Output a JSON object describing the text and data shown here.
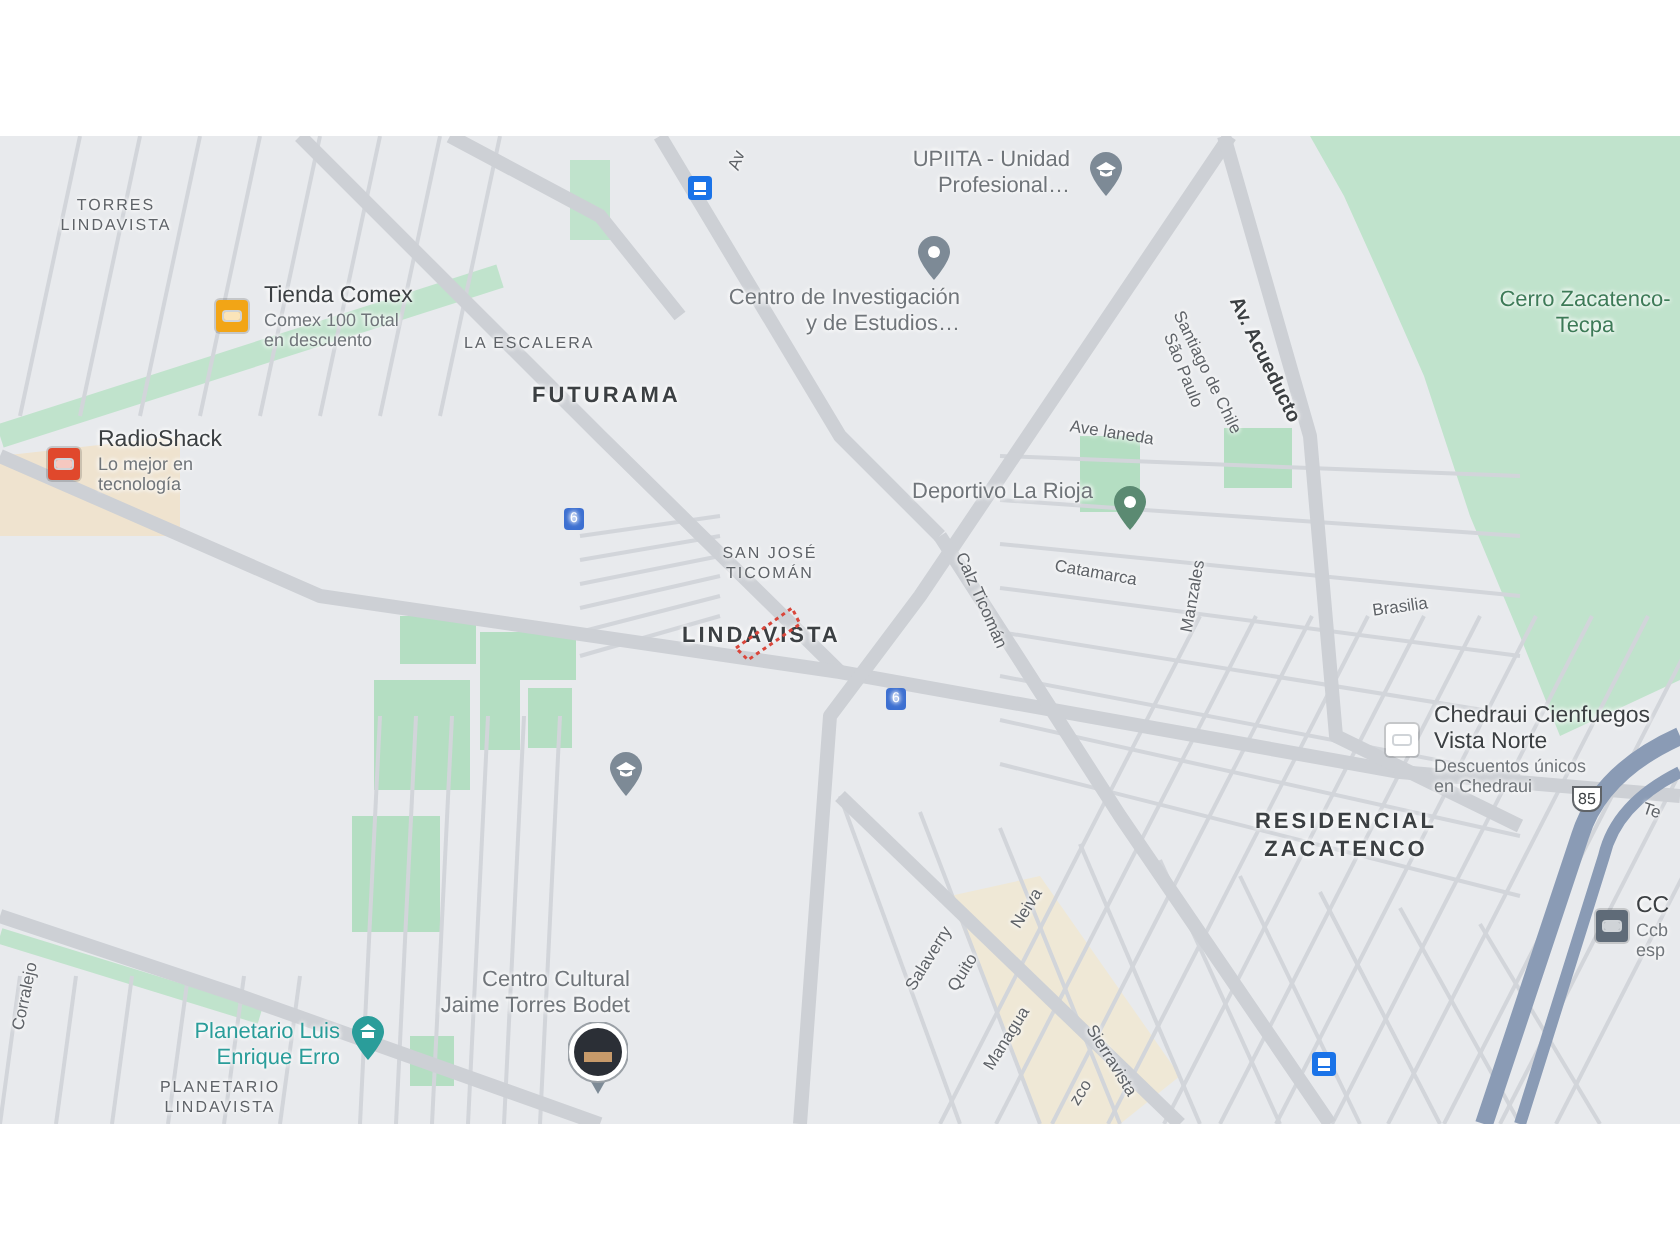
{
  "map": {
    "labels": [
      {
        "kind": "area",
        "text": "TORRES LINDAVISTA"
      },
      {
        "kind": "shop",
        "color": "#f2a516"
      },
      {
        "kind": "poi",
        "title": [
          "Tienda Comex"
        ],
        "details": [
          "Comex 100 Total",
          "en descuento"
        ]
      },
      {
        "kind": "area",
        "text": "LA ESCALERA"
      },
      {
        "kind": "district",
        "text": "FUTURAMA"
      },
      {
        "kind": "shop",
        "color": "#e0482c"
      },
      {
        "kind": "poi",
        "title": [
          "RadioShack"
        ],
        "details": [
          "Lo mejor en",
          "tecnología"
        ]
      },
      {
        "kind": "transit"
      },
      {
        "kind": "street",
        "text": "Av"
      },
      {
        "kind": "place",
        "title": [
          "UPIITA - Unidad",
          "Profesional…"
        ]
      },
      {
        "kind": "school"
      },
      {
        "kind": "pin"
      },
      {
        "kind": "place",
        "title": [
          "Centro de Investigación",
          "y de Estudios…"
        ]
      },
      {
        "kind": "street",
        "text": "Santiago de Chile"
      },
      {
        "kind": "street",
        "text": "São Paulo"
      },
      {
        "kind": "avenue",
        "text": "Av. Acueducto"
      },
      {
        "kind": "park",
        "text": "Cerro Zacatenco-Tecpa"
      },
      {
        "kind": "street",
        "text": "Ave laneda"
      },
      {
        "kind": "place",
        "title": [
          "Deportivo La Rioja"
        ]
      },
      {
        "kind": "parkpin"
      },
      {
        "kind": "area",
        "text": "SAN JOSÉ TICOMÁN"
      },
      {
        "kind": "district",
        "text": "LINDAVISTA"
      },
      {
        "kind": "parcel"
      },
      {
        "kind": "street",
        "text": "Calz Ticomán"
      },
      {
        "kind": "street",
        "text": "Catamarca"
      },
      {
        "kind": "street",
        "text": "Manzales"
      },
      {
        "kind": "street",
        "text": "Brasilia"
      },
      {
        "kind": "shield",
        "text": "6"
      },
      {
        "kind": "shield",
        "text": "6"
      },
      {
        "kind": "shop",
        "color": "#ffffff"
      },
      {
        "kind": "poi",
        "title": [
          "Chedraui Cienfuegos",
          "Vista Norte"
        ],
        "details": [
          "Descuentos únicos",
          "en Chedraui"
        ]
      },
      {
        "kind": "highway",
        "text": "85"
      },
      {
        "kind": "district",
        "text": "RESIDENCIAL ZACATENCO"
      },
      {
        "kind": "street",
        "text": "Te"
      },
      {
        "kind": "shop",
        "color": "#5f6b78"
      },
      {
        "kind": "poi",
        "title": [
          "CC"
        ],
        "details": [
          "Ccb",
          "esp"
        ]
      },
      {
        "kind": "school"
      },
      {
        "kind": "place",
        "title": [
          "Centro Cultural",
          "Jaime Torres Bodet"
        ]
      },
      {
        "kind": "photo"
      },
      {
        "kind": "place",
        "title": [
          "Planetario Luis",
          "Enrique Erro"
        ],
        "color": "#2a9d9a"
      },
      {
        "kind": "museum"
      },
      {
        "kind": "area",
        "text": "PLANETARIO LINDAVISTA"
      },
      {
        "kind": "street",
        "text": "Corralejo"
      },
      {
        "kind": "street",
        "text": "Salaverry"
      },
      {
        "kind": "street",
        "text": "Quito"
      },
      {
        "kind": "street",
        "text": "Neiva"
      },
      {
        "kind": "street",
        "text": "Managua"
      },
      {
        "kind": "street",
        "text": "Sierravista"
      },
      {
        "kind": "street",
        "text": "zco"
      },
      {
        "kind": "transit"
      }
    ]
  }
}
